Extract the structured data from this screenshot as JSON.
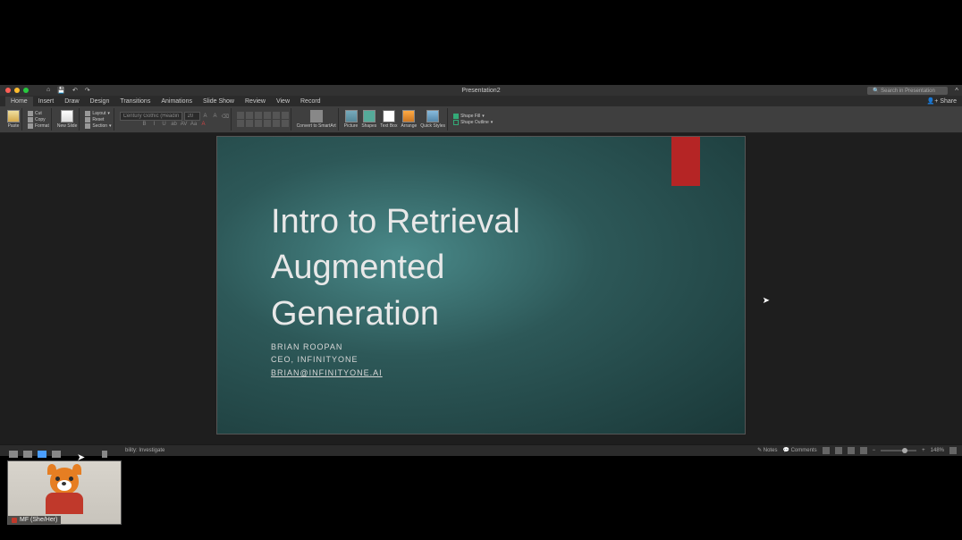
{
  "window": {
    "title": "Presentation2",
    "search_placeholder": "Search in Presentation"
  },
  "tabs": [
    "Home",
    "Insert",
    "Draw",
    "Design",
    "Transitions",
    "Animations",
    "Slide Show",
    "Review",
    "View",
    "Record"
  ],
  "active_tab": "Home",
  "share_label": "Share",
  "ribbon": {
    "paste": "Paste",
    "cut": "Cut",
    "copy": "Copy",
    "format": "Format",
    "new_slide": "New Slide",
    "layout": "Layout",
    "reset": "Reset",
    "section": "Section",
    "font_name": "Century Gothic (Headings)",
    "font_size": "20",
    "convert": "Convert to SmartArt",
    "picture": "Picture",
    "shapes": "Shapes",
    "text_box": "Text Box",
    "arrange": "Arrange",
    "quick_styles": "Quick Styles",
    "shape_fill": "Shape Fill",
    "shape_outline": "Shape Outline"
  },
  "slide": {
    "title_l1": "Intro to Retrieval",
    "title_l2": "Augmented",
    "title_l3": "Generation",
    "author": "BRIAN ROOPAN",
    "role": "CEO, INFINITYONE",
    "email": "BRIAN@INFINITYONE.AI"
  },
  "status": {
    "accessibility": "bility: Investigate",
    "notes": "Notes",
    "comments": "Comments",
    "zoom": "148%"
  },
  "video": {
    "name": "MF (She/Her)"
  }
}
